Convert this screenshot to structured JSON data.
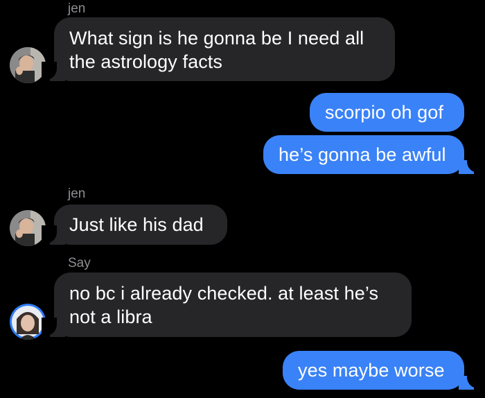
{
  "thread": {
    "messages": [
      {
        "sender": "jen",
        "text": "What sign is he gonna be I need all the astrology facts",
        "direction": "incoming"
      },
      {
        "text": "scorpio oh gof",
        "direction": "outgoing"
      },
      {
        "text": "he’s gonna be awful",
        "direction": "outgoing"
      },
      {
        "sender": "jen",
        "text": "Just like his dad",
        "direction": "incoming"
      },
      {
        "sender": "Say",
        "text": "no bc i already checked. at least he’s not a libra",
        "direction": "incoming"
      },
      {
        "text": "yes maybe worse",
        "direction": "outgoing"
      }
    ]
  },
  "colors": {
    "background": "#000000",
    "incoming_bubble": "#262628",
    "outgoing_bubble": "#3a82f7",
    "sender_label": "#8e8e93",
    "message_text": "#ffffff"
  },
  "icons": {
    "jen_avatar": "person-photo-avatar",
    "say_avatar": "person-photo-avatar-blue-ring"
  }
}
